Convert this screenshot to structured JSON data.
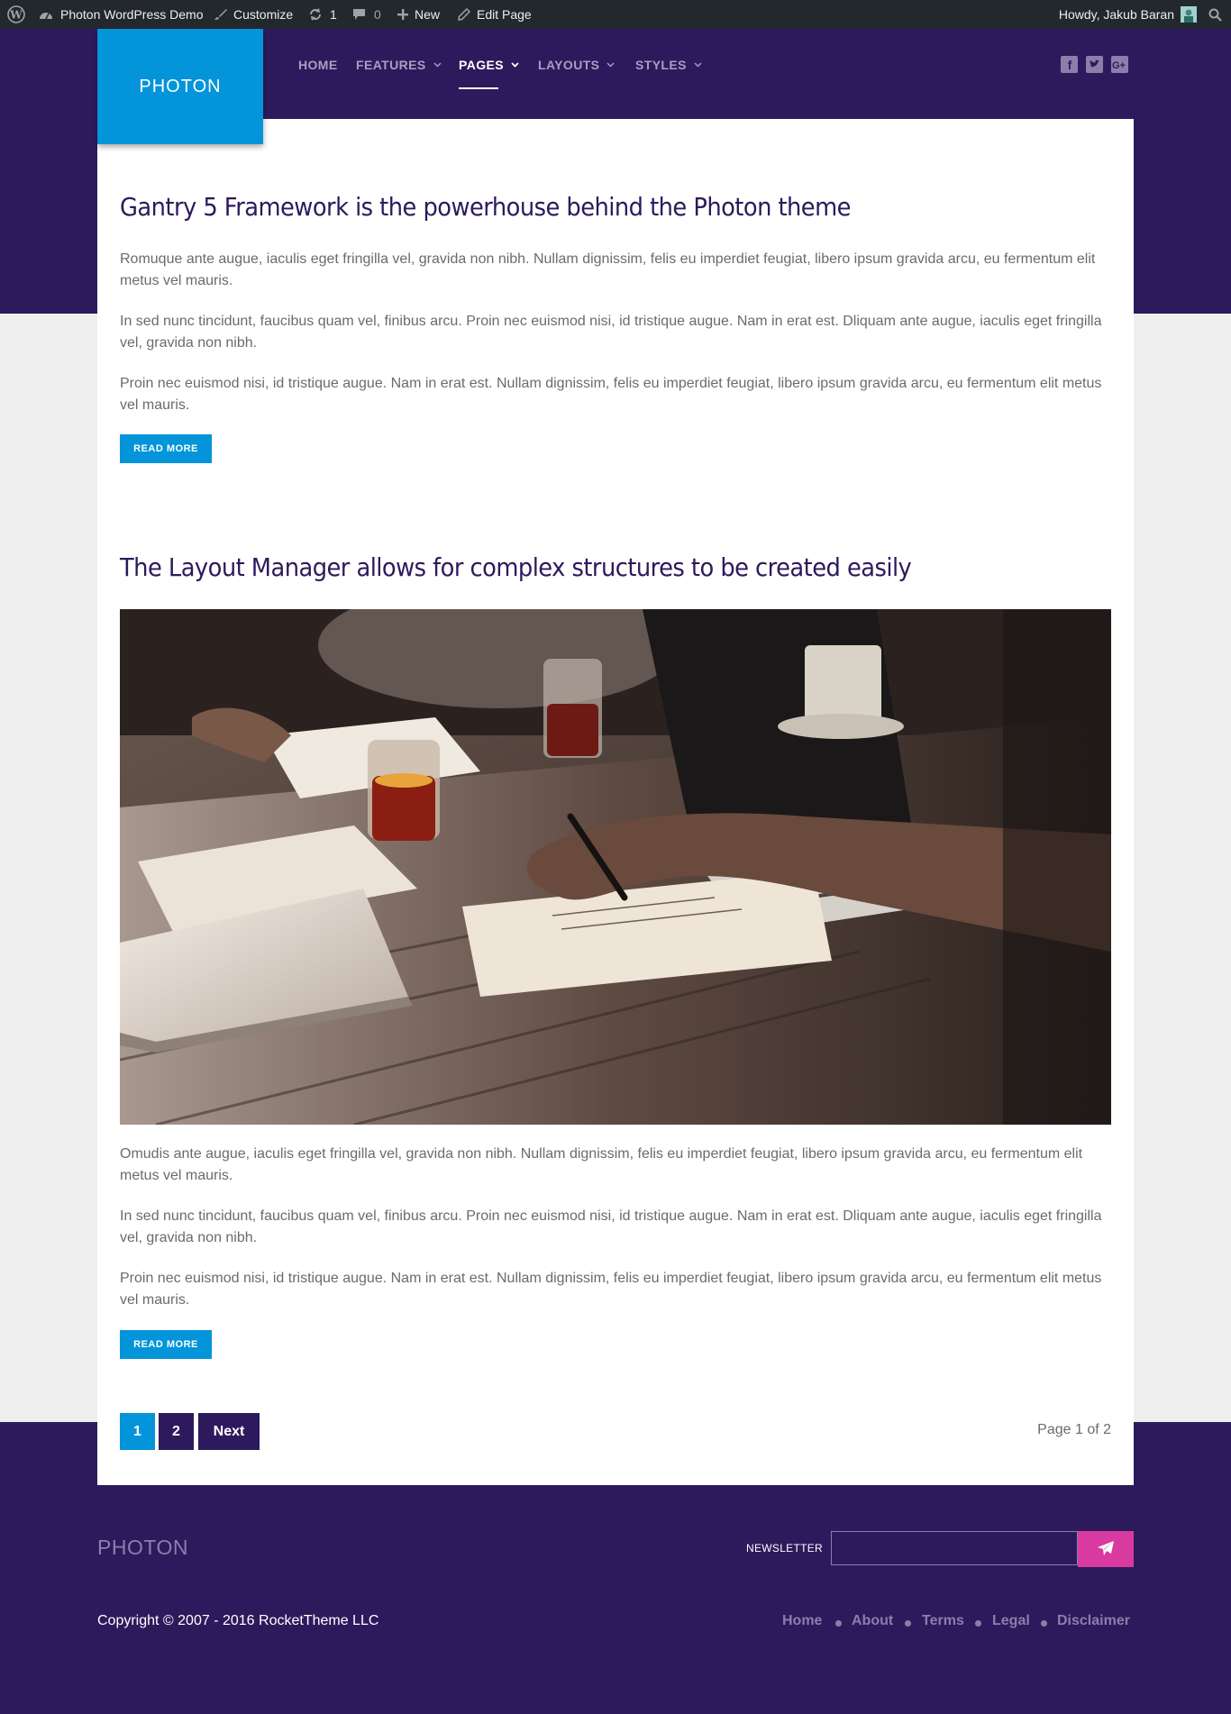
{
  "adminbar": {
    "site_name": "Photon WordPress Demo",
    "customize": "Customize",
    "updates_count": "1",
    "comments_count": "0",
    "new_label": "New",
    "edit_label": "Edit Page",
    "howdy": "Howdy, Jakub Baran"
  },
  "header": {
    "logo": "PHOTON",
    "nav": [
      {
        "label": "HOME"
      },
      {
        "label": "FEATURES"
      },
      {
        "label": "PAGES"
      },
      {
        "label": "LAYOUTS"
      },
      {
        "label": "STYLES"
      }
    ],
    "active_nav": "PAGES",
    "social": [
      "facebook-icon",
      "twitter-icon",
      "google-plus-icon"
    ]
  },
  "posts": [
    {
      "title": "Gantry 5 Framework is the powerhouse behind the Photon theme",
      "paragraphs": [
        "Romuque ante augue, iaculis eget fringilla vel, gravida non nibh. Nullam dignissim, felis eu imperdiet feugiat, libero ipsum gravida arcu, eu fermentum elit metus vel mauris.",
        "In sed nunc tincidunt, faucibus quam vel, finibus arcu. Proin nec euismod nisi, id tristique augue. Nam in erat est. Dliquam ante augue, iaculis eget fringilla vel, gravida non nibh.",
        "Proin nec euismod nisi, id tristique augue. Nam in erat est. Nullam dignissim, felis eu imperdiet feugiat, libero ipsum gravida arcu, eu fermentum elit metus vel mauris."
      ],
      "read_more": "READ MORE"
    },
    {
      "title": "The Layout Manager allows for complex structures to be created easily",
      "paragraphs": [
        "Omudis ante augue, iaculis eget fringilla vel, gravida non nibh. Nullam dignissim, felis eu imperdiet feugiat, libero ipsum gravida arcu, eu fermentum elit metus vel mauris.",
        "In sed nunc tincidunt, faucibus quam vel, finibus arcu. Proin nec euismod nisi, id tristique augue. Nam in erat est. Dliquam ante augue, iaculis eget fringilla vel, gravida non nibh.",
        "Proin nec euismod nisi, id tristique augue. Nam in erat est. Nullam dignissim, felis eu imperdiet feugiat, libero ipsum gravida arcu, eu fermentum elit metus vel mauris."
      ],
      "read_more": "READ MORE"
    }
  ],
  "pagination": {
    "pages": [
      "1",
      "2"
    ],
    "current": "1",
    "next": "Next",
    "info": "Page 1 of 2"
  },
  "footer": {
    "logo": "PHOTON",
    "newsletter_label": "NEWSLETTER",
    "newsletter_value": "",
    "copyright": "Copyright © 2007 - 2016 RocketTheme LLC",
    "links": [
      "Home",
      "About",
      "Terms",
      "Legal",
      "Disclaimer"
    ]
  },
  "colors": {
    "brand_purple": "#2d1a5c",
    "accent_blue": "#0394d9",
    "accent_pink": "#d83aa0",
    "adminbar": "#23282d"
  }
}
